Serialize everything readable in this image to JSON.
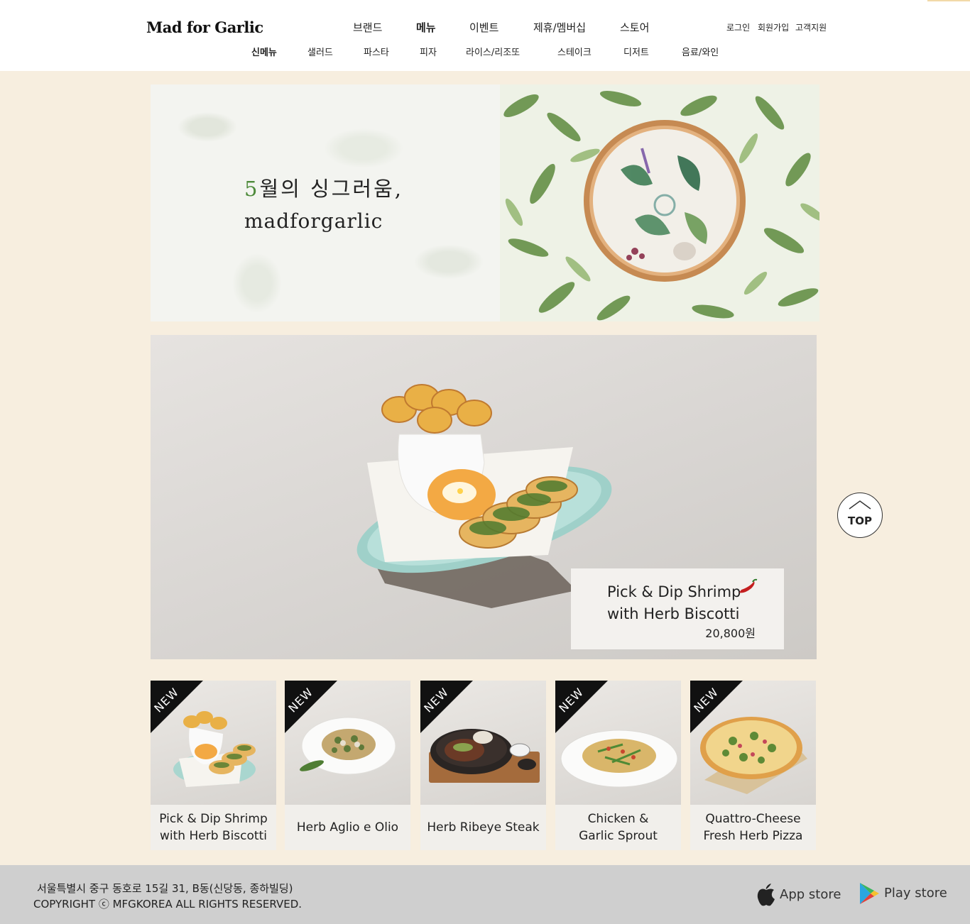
{
  "header": {
    "logo": "Mad for Garlic",
    "top_nav": [
      "브랜드",
      "메뉴",
      "이벤트",
      "제휴/멤버십",
      "스토어"
    ],
    "util_links": [
      "로그인",
      "회원가입",
      "고객지원"
    ],
    "sub_nav": [
      "신메뉴",
      "샐러드",
      "파스타",
      "피자",
      "라이스/리조또",
      "스테이크",
      "디저트",
      "음료/와인"
    ]
  },
  "banner": {
    "highlight": "5",
    "line1_rest": "월의 싱그러움,",
    "line2": "madforgarlic"
  },
  "feature": {
    "name": "Pick & Dip Shrimp\nwith Herb Biscotti",
    "price": "20,800원"
  },
  "top_button": "TOP",
  "menu_cards": [
    {
      "badge": "NEW",
      "name": "Pick & Dip Shrimp\nwith Herb Biscotti"
    },
    {
      "badge": "NEW",
      "name": "Herb Aglio e Olio"
    },
    {
      "badge": "NEW",
      "name": "Herb Ribeye Steak"
    },
    {
      "badge": "NEW",
      "name": "Chicken &\nGarlic Sprout"
    },
    {
      "badge": "NEW",
      "name": "Quattro-Cheese\nFresh Herb Pizza"
    }
  ],
  "footer": {
    "address": "서울특별시 중구 동호로 15길 31, B동(신당동, 종하빌딩)",
    "copyright": "COPYRIGHT ⓒ MFGKOREA ALL RIGHTS RESERVED.",
    "app_store": "App store",
    "play_store": "Play store"
  },
  "icons": {
    "logo": "mad-for-garlic-logo",
    "chili": "chili-pepper-icon",
    "top": "chevron-up-icon",
    "apple": "apple-icon",
    "play": "google-play-icon"
  },
  "colors": {
    "page_bg": "#f7eedf",
    "header_bg": "#ffffff",
    "footer_bg": "#cfcfcf",
    "accent_green": "#4d8a3a",
    "badge": "#111111"
  }
}
